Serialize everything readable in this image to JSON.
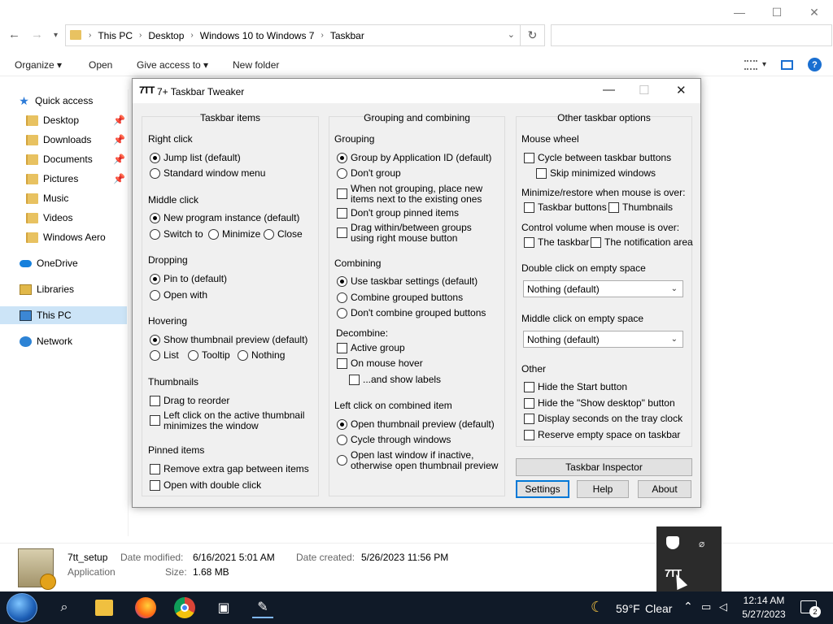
{
  "explorer": {
    "window_controls": {
      "minimize": "—",
      "maximize": "☐",
      "close": "✕"
    },
    "breadcrumb": [
      "This PC",
      "Desktop",
      "Windows 10 to Windows 7",
      "Taskbar"
    ],
    "toolbar": {
      "organize": "Organize ▾",
      "open": "Open",
      "give_access": "Give access to ▾",
      "new_folder": "New folder"
    },
    "sidebar": [
      {
        "label": "Quick access",
        "icon": "star-icon"
      },
      {
        "label": "Desktop",
        "icon": "folder-icon",
        "pinned": true
      },
      {
        "label": "Downloads",
        "icon": "folder-icon",
        "pinned": true
      },
      {
        "label": "Documents",
        "icon": "folder-icon",
        "pinned": true
      },
      {
        "label": "Pictures",
        "icon": "folder-icon",
        "pinned": true
      },
      {
        "label": "Music",
        "icon": "folder-icon"
      },
      {
        "label": "Videos",
        "icon": "folder-icon"
      },
      {
        "label": "Windows Aero",
        "icon": "folder-icon"
      },
      {
        "label": "OneDrive",
        "icon": "cloud-icon"
      },
      {
        "label": "Libraries",
        "icon": "library-icon"
      },
      {
        "label": "This PC",
        "icon": "computer-icon",
        "selected": true
      },
      {
        "label": "Network",
        "icon": "network-icon"
      }
    ],
    "details": {
      "name": "7tt_setup",
      "type": "Application",
      "date_modified_label": "Date modified:",
      "date_modified": "6/16/2021 5:01 AM",
      "date_created_label": "Date created:",
      "date_created": "5/26/2023 11:56 PM",
      "size_label": "Size:",
      "size": "1.68 MB"
    }
  },
  "dialog": {
    "icon": "7TT",
    "title": "7+ Taskbar Tweaker",
    "controls": {
      "minimize": "—",
      "maximize": "☐",
      "close": "✕"
    },
    "col1": {
      "header": "Taskbar items",
      "right_click": {
        "label": "Right click",
        "opt1": "Jump list (default)",
        "opt2": "Standard window menu"
      },
      "middle_click": {
        "label": "Middle click",
        "opt1": "New program instance (default)",
        "opt2": "Switch to",
        "opt3": "Minimize",
        "opt4": "Close"
      },
      "dropping": {
        "label": "Dropping",
        "opt1": "Pin to (default)",
        "opt2": "Open with"
      },
      "hovering": {
        "label": "Hovering",
        "opt1": "Show thumbnail preview (default)",
        "opt2": "List",
        "opt3": "Tooltip",
        "opt4": "Nothing"
      },
      "thumbnails": {
        "label": "Thumbnails",
        "opt1": "Drag to reorder",
        "opt2a": "Left click on the active thumbnail",
        "opt2b": "minimizes the window"
      },
      "pinned": {
        "label": "Pinned items",
        "opt1": "Remove extra gap between items",
        "opt2": "Open with double click"
      }
    },
    "col2": {
      "header": "Grouping and combining",
      "grouping": {
        "label": "Grouping",
        "opt1": "Group by Application ID (default)",
        "opt2": "Don't group",
        "opt3a": "When not grouping, place new",
        "opt3b": "items next to the existing ones",
        "opt4": "Don't group pinned items",
        "opt5a": "Drag within/between groups",
        "opt5b": "using right mouse button"
      },
      "combining": {
        "label": "Combining",
        "opt1": "Use taskbar settings (default)",
        "opt2": "Combine grouped buttons",
        "opt3": "Don't combine grouped buttons"
      },
      "decombine": {
        "label": "Decombine:",
        "opt1": "Active group",
        "opt2": "On mouse hover",
        "opt3": "...and show labels"
      },
      "left_click": {
        "label": "Left click on combined item",
        "opt1": "Open thumbnail preview (default)",
        "opt2": "Cycle through windows",
        "opt3a": "Open last window if inactive,",
        "opt3b": "otherwise open thumbnail preview"
      }
    },
    "col3": {
      "header": "Other taskbar options",
      "mouse_wheel": {
        "label": "Mouse wheel",
        "opt1": "Cycle between taskbar buttons",
        "opt2": "Skip minimized windows"
      },
      "minimize_restore": {
        "label": "Minimize/restore when mouse is over:",
        "opt1": "Taskbar buttons",
        "opt2": "Thumbnails"
      },
      "control_volume": {
        "label": "Control volume when mouse is over:",
        "opt1": "The taskbar",
        "opt2": "The notification area"
      },
      "double_click": {
        "label": "Double click on empty space",
        "value": "Nothing (default)"
      },
      "middle_click": {
        "label": "Middle click on empty space",
        "value": "Nothing (default)"
      },
      "other": {
        "label": "Other",
        "opt1": "Hide the Start button",
        "opt2": "Hide the \"Show desktop\" button",
        "opt3": "Display seconds on the tray clock",
        "opt4": "Reserve empty space on taskbar"
      },
      "inspector": "Taskbar Inspector"
    },
    "buttons": {
      "settings": "Settings",
      "help": "Help",
      "about": "About"
    }
  },
  "taskbar": {
    "weather_temp": "59°F",
    "weather_desc": "Clear",
    "time": "12:14 AM",
    "date": "5/27/2023",
    "notification_count": "2",
    "tray_popup_app": "7TT"
  }
}
